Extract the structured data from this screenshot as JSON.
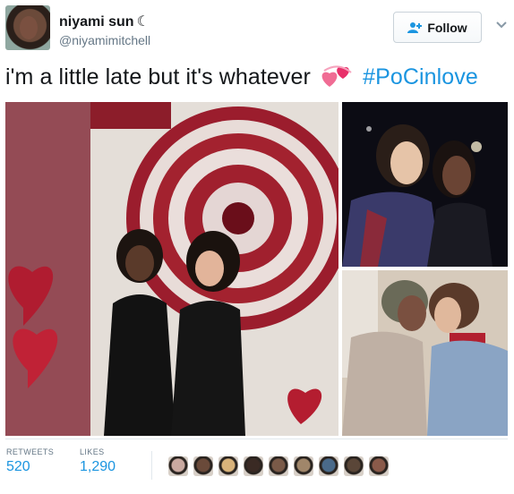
{
  "user": {
    "name": "niyami sun",
    "name_symbol": "☾",
    "handle": "@niyamimitchell"
  },
  "follow_button": {
    "label": "Follow",
    "icon": "add-user-icon"
  },
  "menu": {
    "icon": "chevron-down-icon"
  },
  "tweet": {
    "text": "i'm a little late but it's whatever",
    "emoji": "revolving-hearts-icon",
    "hashtag": "#PoCinlove"
  },
  "stats": {
    "retweets_label": "RETWEETS",
    "retweets_value": "520",
    "likes_label": "LIKES",
    "likes_value": "1,290"
  },
  "likers": [
    {
      "name": "liker-avatar-1",
      "color": "#c9a9a0"
    },
    {
      "name": "liker-avatar-2",
      "color": "#6a4a3a"
    },
    {
      "name": "liker-avatar-3",
      "color": "#d8b27a"
    },
    {
      "name": "liker-avatar-4",
      "color": "#3a2a24"
    },
    {
      "name": "liker-avatar-5",
      "color": "#7a5a48"
    },
    {
      "name": "liker-avatar-6",
      "color": "#a0866a"
    },
    {
      "name": "liker-avatar-7",
      "color": "#4a6a8a"
    },
    {
      "name": "liker-avatar-8",
      "color": "#5a4638"
    },
    {
      "name": "liker-avatar-9",
      "color": "#8a5a4a"
    }
  ],
  "colors": {
    "link": "#1b95e0",
    "text": "#14171a",
    "muted": "#657786",
    "heart": "#e8306a"
  }
}
